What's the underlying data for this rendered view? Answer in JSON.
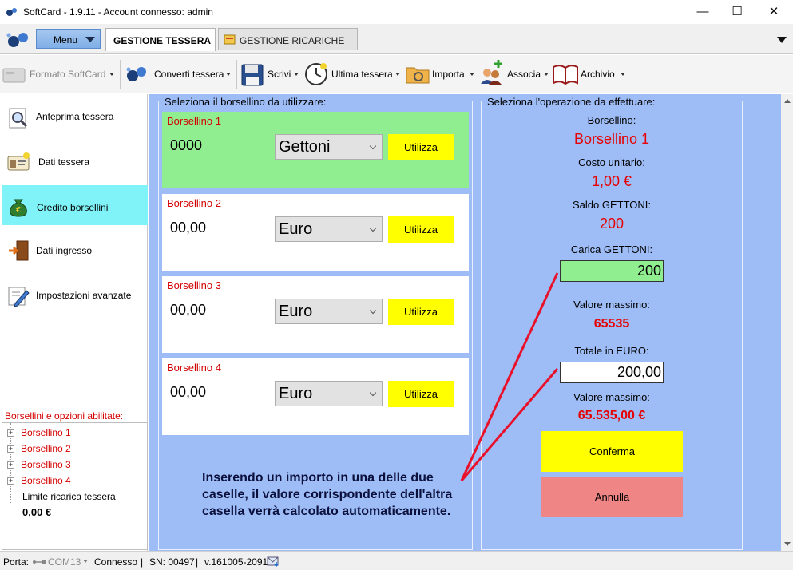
{
  "window": {
    "title": "SoftCard - 1.9.11 - Account connesso: admin",
    "controls": {
      "minimize": "—",
      "maximize": "☐",
      "close": "✕"
    }
  },
  "menu": {
    "label": "Menu"
  },
  "tabs": [
    {
      "label": "GESTIONE TESSERA",
      "active": true
    },
    {
      "label": "GESTIONE RICARICHE",
      "active": false
    }
  ],
  "toolbar": {
    "formato": "Formato SoftCard",
    "converti": "Converti tessera",
    "scrivi": "Scrivi",
    "ultima": "Ultima tessera",
    "importa": "Importa",
    "associa": "Associa",
    "archivio": "Archivio"
  },
  "sidebar": {
    "items": [
      {
        "label": "Anteprima tessera",
        "icon": "magnifier-icon"
      },
      {
        "label": "Dati tessera",
        "icon": "id-card-icon"
      },
      {
        "label": "Credito borsellini",
        "icon": "money-bag-icon",
        "active": true
      },
      {
        "label": "Dati ingresso",
        "icon": "door-icon"
      },
      {
        "label": "Impostazioni avanzate",
        "icon": "settings-pencil-icon"
      }
    ],
    "options_title": "Borsellini e opzioni abilitate:",
    "tree": [
      "Borsellino 1",
      "Borsellino 2",
      "Borsellino 3",
      "Borsellino 4"
    ],
    "limit_label": "Limite ricarica tessera",
    "limit_value": "0,00 €"
  },
  "left_panel": {
    "title": "Seleziona il borsellino da utilizzare:",
    "purses": [
      {
        "name": "Borsellino 1",
        "value": "0000",
        "currency": "Gettoni",
        "button": "Utilizza",
        "selected": true
      },
      {
        "name": "Borsellino 2",
        "value": "00,00",
        "currency": "Euro",
        "button": "Utilizza",
        "selected": false
      },
      {
        "name": "Borsellino 3",
        "value": "00,00",
        "currency": "Euro",
        "button": "Utilizza",
        "selected": false
      },
      {
        "name": "Borsellino 4",
        "value": "00,00",
        "currency": "Euro",
        "button": "Utilizza",
        "selected": false
      }
    ],
    "annotation": "Inserendo un importo in una delle due caselle, il valore corrispondente dell'altra casella verrà calcolato automaticamente."
  },
  "right_panel": {
    "title": "Seleziona l'operazione da effettuare:",
    "borsellino_label": "Borsellino:",
    "borsellino_value": "Borsellino 1",
    "costo_label": "Costo unitario:",
    "costo_value": "1,00 €",
    "saldo_label": "Saldo GETTONI:",
    "saldo_value": "200",
    "carica_label": "Carica GETTONI:",
    "carica_input": "200",
    "max1_label": "Valore massimo:",
    "max1_value": "65535",
    "totale_label": "Totale in EURO:",
    "totale_input": "200,00",
    "max2_label": "Valore massimo:",
    "max2_value": "65.535,00 €",
    "confirm": "Conferma",
    "cancel": "Annulla"
  },
  "status": {
    "porta_label": "Porta:",
    "port": "COM13",
    "connection": "Connesso",
    "serial": "SN: 00497",
    "version": "v.161005-2091"
  },
  "colors": {
    "main_bg": "#9ebdf6",
    "selected_purse": "#90ee90",
    "accent_red": "#e60000",
    "button_yellow": "#ffff00",
    "cancel_red": "#ef8585",
    "active_nav": "#7ff3f7"
  }
}
